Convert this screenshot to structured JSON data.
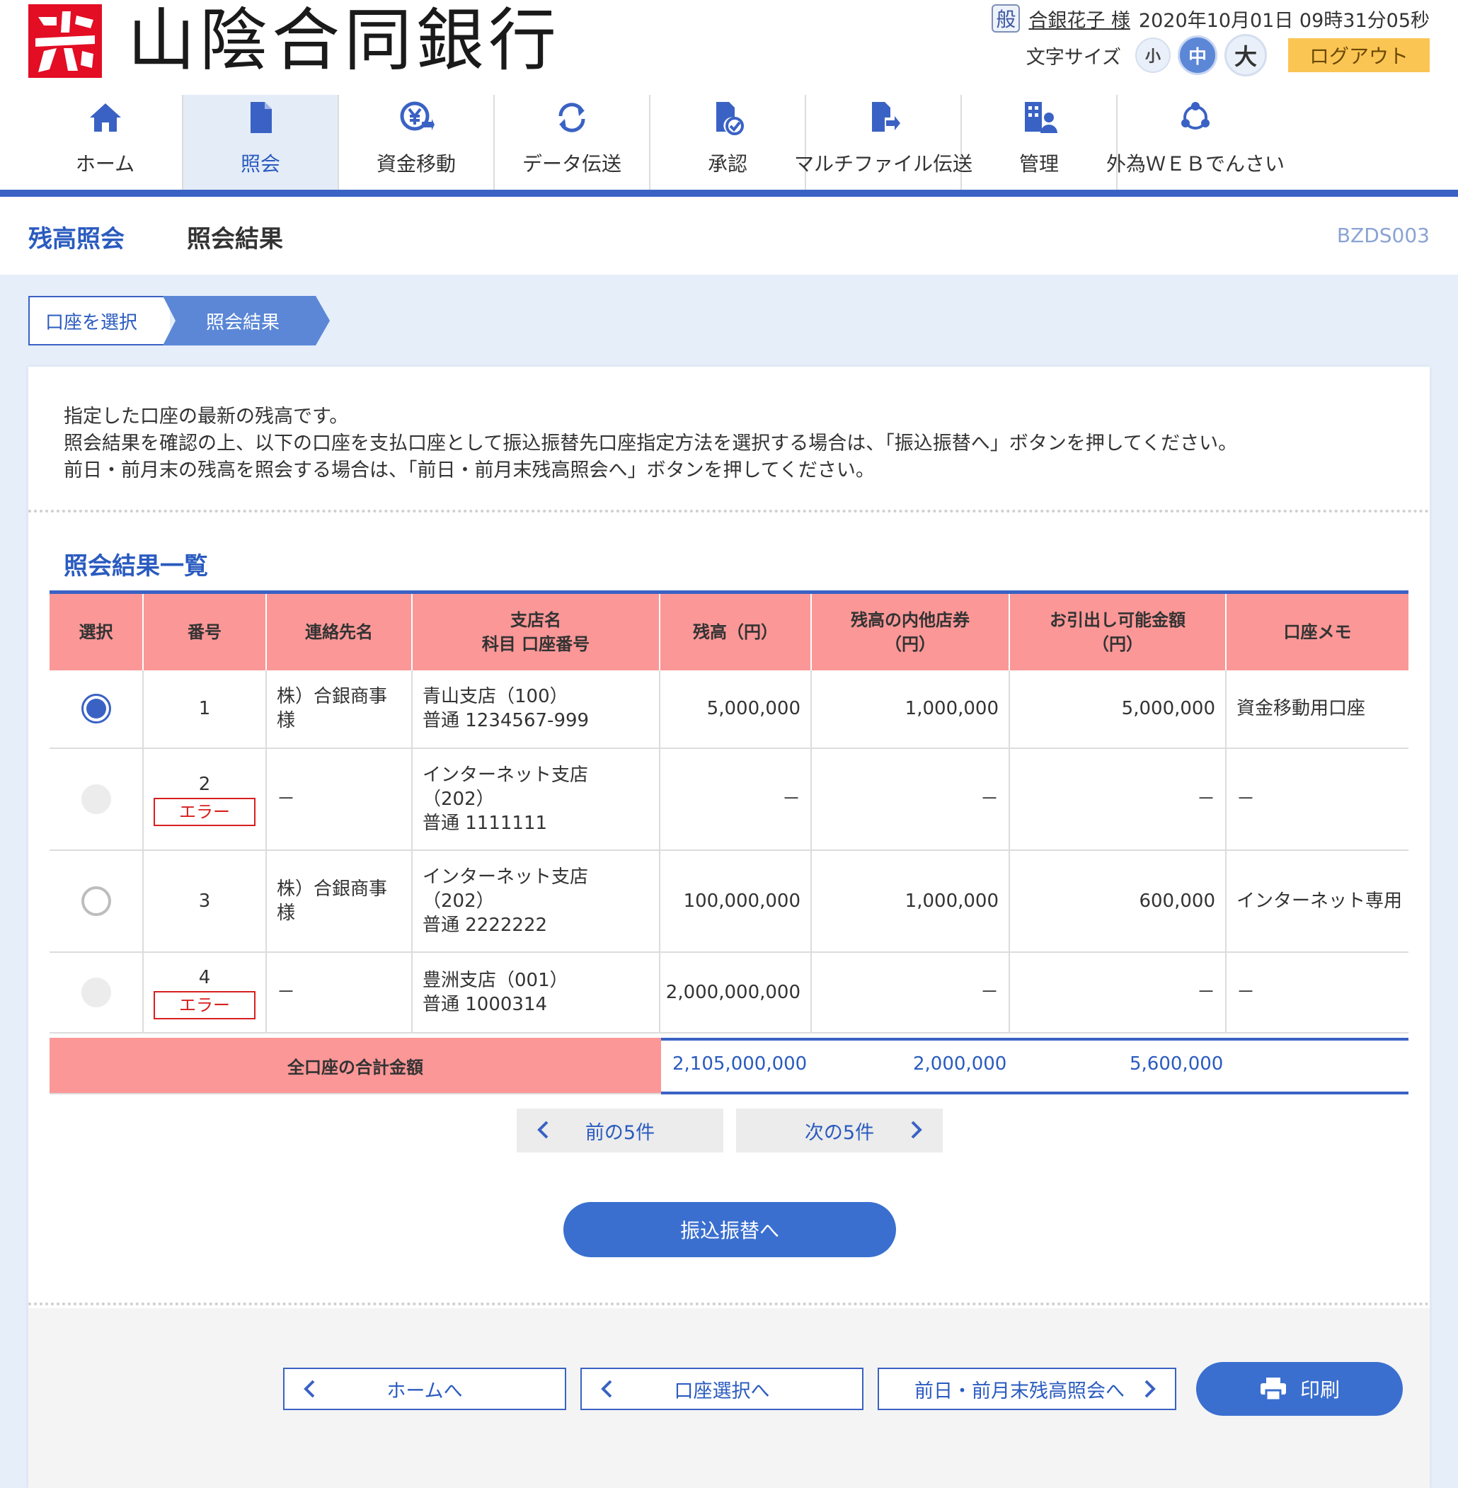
{
  "header": {
    "bank_name": "山陰合同銀行",
    "user_badge": "般",
    "user_name": "合銀花子 様",
    "datetime": "2020年10月01日 09時31分05秒",
    "font_size_label": "文字サイズ",
    "font_small": "小",
    "font_medium": "中",
    "font_large": "大",
    "logout": "ログアウト"
  },
  "nav": {
    "home": "ホーム",
    "inquiry": "照会",
    "fund_transfer": "資金移動",
    "data_transfer": "データ伝送",
    "approval": "承認",
    "multi_file_1": "マルチファイル",
    "multi_file_2": "伝送",
    "management": "管理",
    "fx_web_1": "外為ＷＥＢ",
    "fx_web_2": "でんさい"
  },
  "title": {
    "main": "残高照会",
    "sub": "照会結果",
    "screen_id": "BZDS003"
  },
  "steps": {
    "step1": "口座を選択",
    "step2": "照会結果"
  },
  "description": {
    "line1": "指定した口座の最新の残高です。",
    "line2": "照会結果を確認の上、以下の口座を支払口座として振込振替先口座指定方法を選択する場合は、「振込振替へ」ボタンを押してください。",
    "line3": "前日・前月末の残高を照会する場合は、「前日・前月末残高照会へ」ボタンを押してください。"
  },
  "section_title": "照会結果一覧",
  "table": {
    "headers": {
      "select": "選択",
      "number": "番号",
      "contact": "連絡先名",
      "branch_1": "支店名",
      "branch_2": "科目 口座番号",
      "balance": "残高（円）",
      "other_1": "残高の内他店券",
      "other_2": "（円）",
      "available_1": "お引出し可能金額",
      "available_2": "（円）",
      "memo": "口座メモ"
    },
    "rows": [
      {
        "no": "1",
        "contact_1": "株）合銀商事",
        "contact_2": "様",
        "branch_1": "青山支店（100）",
        "branch_2": "普通 1234567-999",
        "balance": "5,000,000",
        "other": "1,000,000",
        "available": "5,000,000",
        "memo": "資金移動用口座"
      },
      {
        "no": "2",
        "error": "エラー",
        "contact": "－",
        "branch_1": "インターネット支店",
        "branch_2": "（202）",
        "branch_3": "普通 1111111",
        "balance": "－",
        "other": "－",
        "available": "－",
        "memo": "－"
      },
      {
        "no": "3",
        "contact_1": "株）合銀商事",
        "contact_2": "様",
        "branch_1": "インターネット支店",
        "branch_2": "（202）",
        "branch_3": "普通 2222222",
        "balance": "100,000,000",
        "other": "1,000,000",
        "available": "600,000",
        "memo": "インターネット専用"
      },
      {
        "no": "4",
        "error": "エラー",
        "contact": "－",
        "branch_1": "豊洲支店（001）",
        "branch_2": "普通 1000314",
        "balance": "2,000,000,000",
        "other": "－",
        "available": "－",
        "memo": "－"
      }
    ],
    "total_label": "全口座の合計金額",
    "total_balance": "2,105,000,000",
    "total_other": "2,000,000",
    "total_available": "5,600,000"
  },
  "pager": {
    "prev": "前の5件",
    "next": "次の5件"
  },
  "buttons": {
    "transfer": "振込振替へ",
    "home": "ホームへ",
    "account_select": "口座選択へ",
    "previous_balance": "前日・前月末残高照会へ",
    "print": "印刷"
  },
  "colors": {
    "primary": "#3a62c4",
    "table_header": "#fb9797",
    "error": "#d81f1f",
    "logout": "#fbc554",
    "logo": "#e30d24"
  }
}
